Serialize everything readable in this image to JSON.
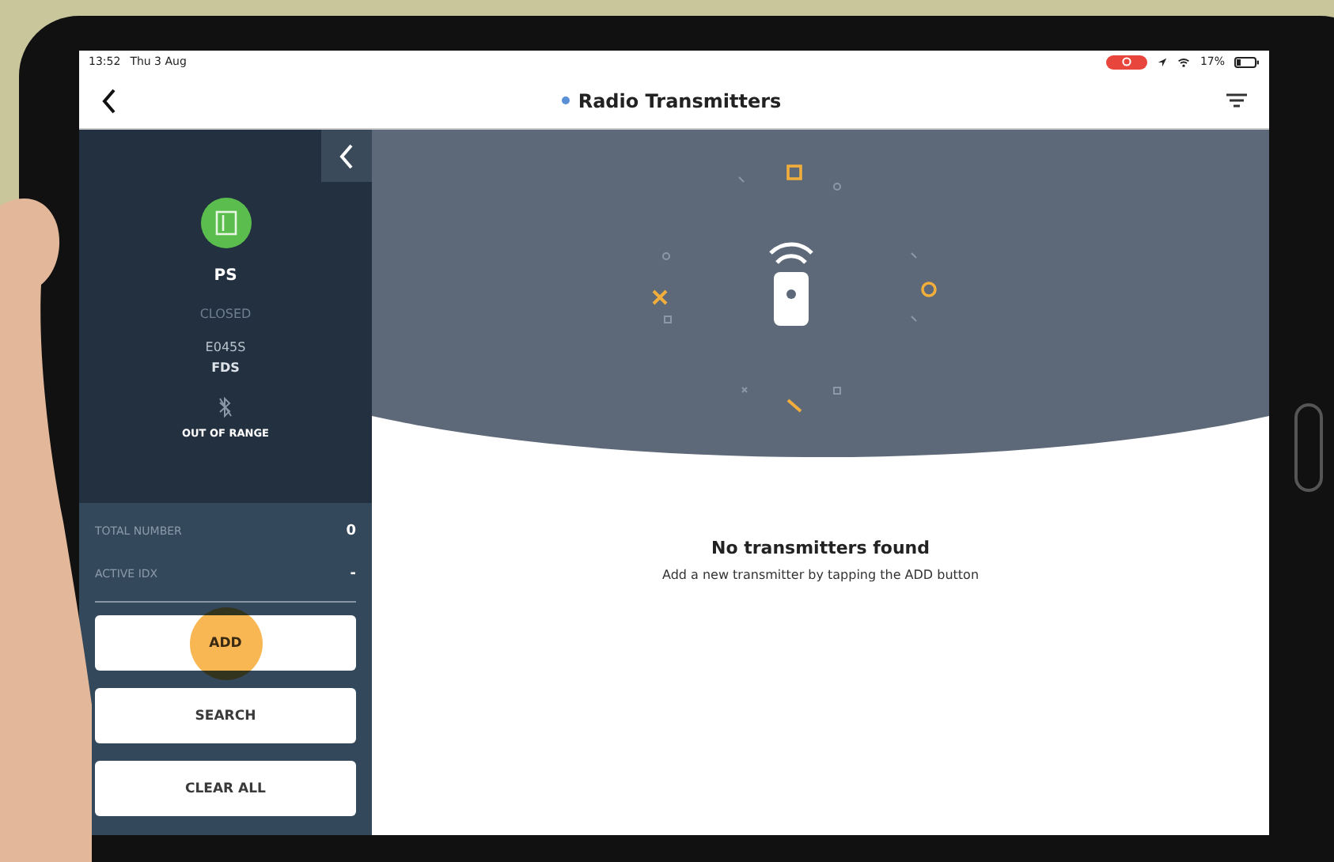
{
  "status_bar": {
    "time": "13:52",
    "date": "Thu 3 Aug",
    "battery": "17%",
    "recording": true
  },
  "nav": {
    "title": "Radio Transmitters"
  },
  "device": {
    "name": "PS",
    "state": "CLOSED",
    "code": "E045S",
    "group": "FDS",
    "signal": "OUT OF RANGE"
  },
  "stats": [
    {
      "label": "TOTAL NUMBER",
      "value": "0"
    },
    {
      "label": "ACTIVE IDX",
      "value": "-"
    }
  ],
  "buttons": [
    {
      "label": "ADD",
      "pressed": true
    },
    {
      "label": "SEARCH",
      "pressed": false
    },
    {
      "label": "CLEAR ALL",
      "pressed": false
    }
  ],
  "empty": {
    "title": "No transmitters found",
    "message": "Add a new transmitter by tapping the ADD button"
  }
}
